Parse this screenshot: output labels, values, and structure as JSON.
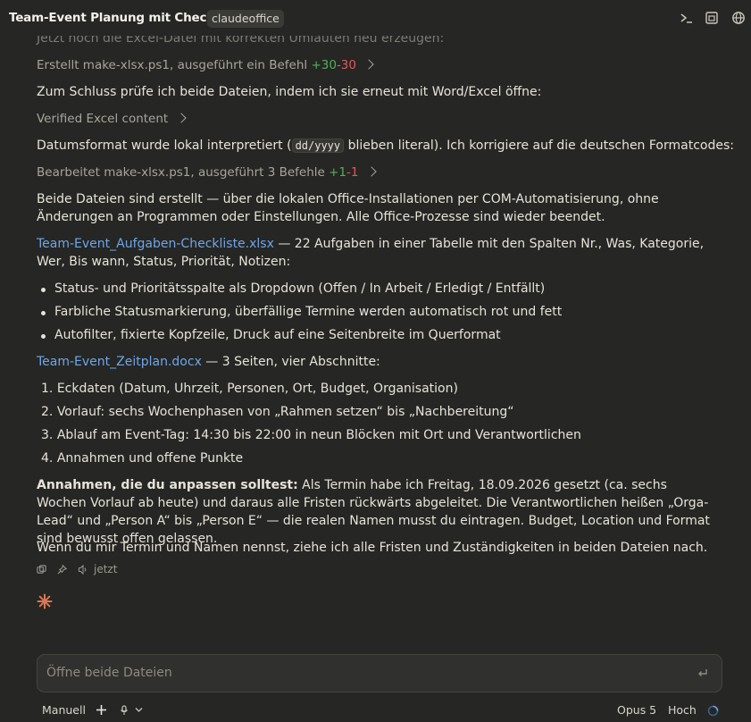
{
  "header": {
    "title": "Team-Event Planung mit Checkliste",
    "badge": "claudeoffice",
    "icons": [
      "terminal-icon",
      "sidebar-icon",
      "globe-icon"
    ]
  },
  "messages": {
    "cutoff_line": "Jetzt noch die Excel-Datei mit korrekten Umlauten neu erzeugen:",
    "tool1": {
      "label": "Erstellt make-xlsx.ps1, ausgeführt ein Befehl",
      "added": "+30",
      "removed": "-30"
    },
    "check_line": "Zum Schluss prüfe ich beide Dateien, indem ich sie erneut mit Word/Excel öffne:",
    "tool2": {
      "label": "Verified Excel content"
    },
    "date_pre": "Datumsformat wurde lokal interpretiert (",
    "date_code": "dd/yyyy",
    "date_post": " blieben literal). Ich korrigiere auf die deutschen Formatcodes:",
    "tool3": {
      "label": "Bearbeitet make-xlsx.ps1, ausgeführt 3 Befehle",
      "added": "+1",
      "removed": "-1"
    },
    "summary": "Beide Dateien sind erstellt — über die lokalen Office-Installationen per COM-Automatisierung, ohne Änderungen an Programmen oder Einstellungen. Alle Office-Prozesse sind wieder beendet.",
    "xlsx_link": "Team-Event_Aufgaben-Checkliste.xlsx",
    "xlsx_desc": " — 22 Aufgaben in einer Tabelle mit den Spalten Nr., Was, Kategorie, Wer, Bis wann, Status, Priorität, Notizen:",
    "xlsx_bullets": [
      "Status- und Prioritätsspalte als Dropdown (Offen / In Arbeit / Erledigt / Entfällt)",
      "Farbliche Statusmarkierung, überfällige Termine werden automatisch rot und fett",
      "Autofilter, fixierte Kopfzeile, Druck auf eine Seitenbreite im Querformat"
    ],
    "docx_link": "Team-Event_Zeitplan.docx",
    "docx_desc": " — 3 Seiten, vier Abschnitte:",
    "docx_items": [
      "Eckdaten (Datum, Uhrzeit, Personen, Ort, Budget, Organisation)",
      "Vorlauf: sechs Wochenphasen von „Rahmen setzen“ bis „Nachbereitung“",
      "Ablauf am Event-Tag: 14:30 bis 22:00 in neun Blöcken mit Ort und Verantwortlichen",
      "Annahmen und offene Punkte"
    ],
    "docx_numbers": [
      "1.",
      "2.",
      "3.",
      "4."
    ],
    "assumptions_bold": "Annahmen, die du anpassen solltest:",
    "assumptions_text": " Als Termin habe ich Freitag, 18.09.2026 gesetzt (ca. sechs Wochen Vorlauf ab heute) und daraus alle Fristen rückwärts abgeleitet. Die Verantwortlichen heißen „Orga-Lead“ und „Person A“ bis „Person E“ — die realen Namen musst du eintragen. Budget, Location und Format sind bewusst offen gelassen.",
    "closing": "Wenn du mir Termin und Namen nennst, ziehe ich alle Fristen und Zuständigkeiten in beiden Dateien nach.",
    "timestamp": "jetzt"
  },
  "input": {
    "placeholder": "Öffne beide Dateien"
  },
  "footer": {
    "mode": "Manuell",
    "model": "Opus 5",
    "effort": "Hoch"
  },
  "colors": {
    "link": "#6ea6e8",
    "added": "#4fb25a",
    "removed": "#e05a5a",
    "spark": "#d97757"
  }
}
